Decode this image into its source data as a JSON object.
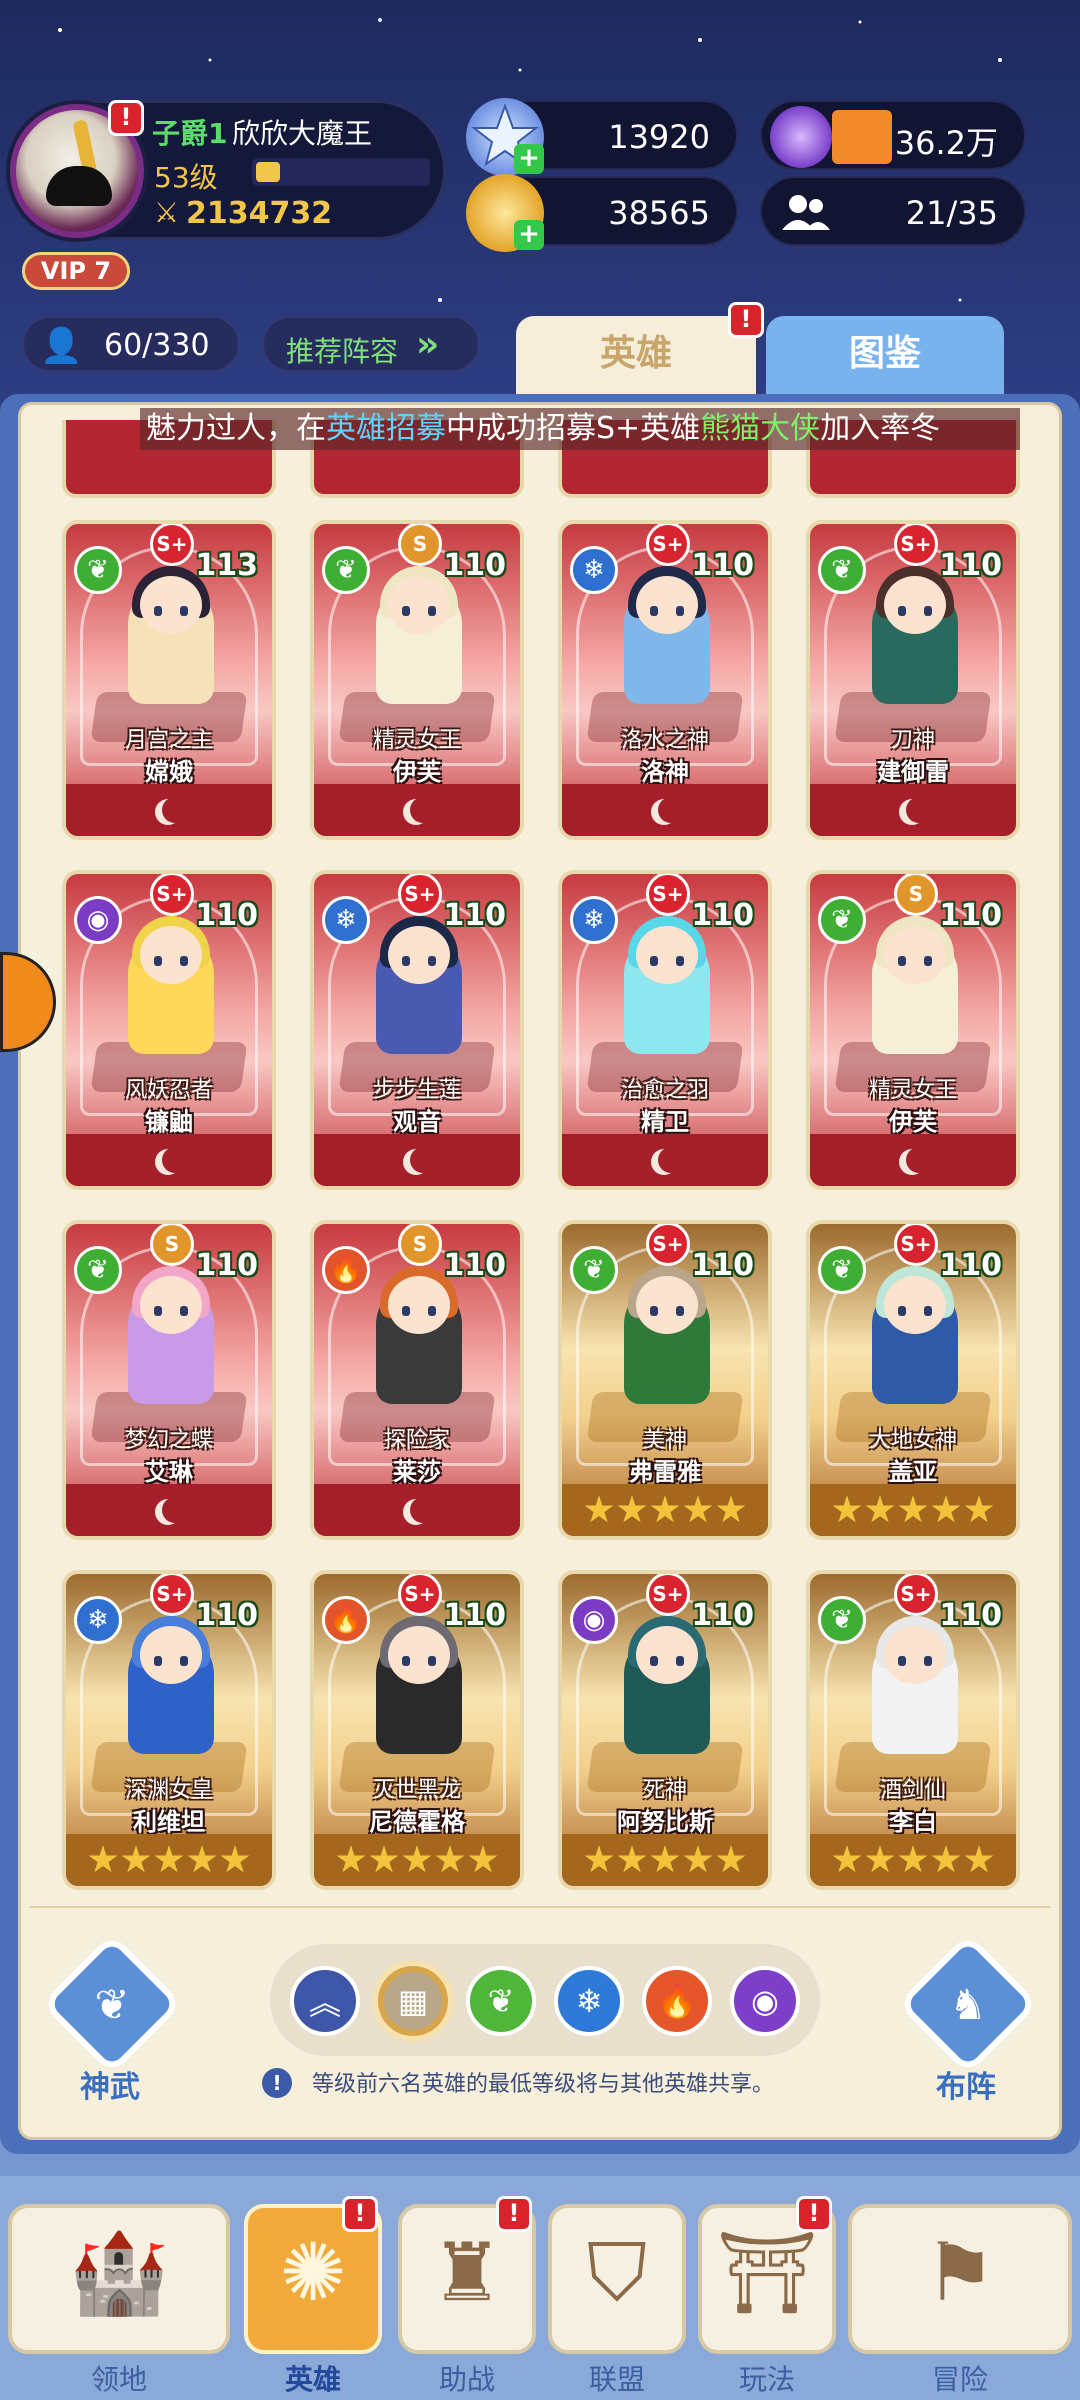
{
  "player": {
    "title": "子爵1",
    "name": "欣欣大魔王",
    "level": "53级",
    "exp_fraction": 0.14,
    "power": "2134732",
    "vip": "VIP 7",
    "alert": "!"
  },
  "resources": {
    "crystals": "13920",
    "gold": "38565",
    "energy": "36.2万",
    "population": "21/35"
  },
  "toolbar": {
    "hero_count": "60/330",
    "recommend_label": "推荐阵容"
  },
  "tabs": [
    {
      "label": "英雄",
      "active": true,
      "alert": "!"
    },
    {
      "label": "图鉴",
      "active": false
    }
  ],
  "marquee": {
    "prefix": "魅力过人，在",
    "link1": "英雄招募",
    "mid": "中成功招募S+英雄",
    "link2": "熊猫大侠",
    "suffix": "加入率冬"
  },
  "heroes": [
    {
      "grade": "S+",
      "element": "nature",
      "level": "113",
      "epithet": "月宫之主",
      "name": "嫦娥",
      "frame": "red"
    },
    {
      "grade": "S",
      "element": "nature",
      "level": "110",
      "epithet": "精灵女王",
      "name": "伊芙",
      "frame": "red"
    },
    {
      "grade": "S+",
      "element": "water",
      "level": "110",
      "epithet": "洛水之神",
      "name": "洛神",
      "frame": "red"
    },
    {
      "grade": "S+",
      "element": "nature",
      "level": "110",
      "epithet": "刀神",
      "name": "建御雷",
      "frame": "red"
    },
    {
      "grade": "S+",
      "element": "dark",
      "level": "110",
      "epithet": "风妖忍者",
      "name": "镰鼬",
      "frame": "red"
    },
    {
      "grade": "S+",
      "element": "water",
      "level": "110",
      "epithet": "步步生莲",
      "name": "观音",
      "frame": "red"
    },
    {
      "grade": "S+",
      "element": "water",
      "level": "110",
      "epithet": "治愈之羽",
      "name": "精卫",
      "frame": "red"
    },
    {
      "grade": "S",
      "element": "nature",
      "level": "110",
      "epithet": "精灵女王",
      "name": "伊芙",
      "frame": "red"
    },
    {
      "grade": "S",
      "element": "nature",
      "level": "110",
      "epithet": "梦幻之蝶",
      "name": "艾琳",
      "frame": "red"
    },
    {
      "grade": "S",
      "element": "fire",
      "level": "110",
      "epithet": "探险家",
      "name": "莱莎",
      "frame": "red"
    },
    {
      "grade": "S+",
      "element": "nature",
      "level": "110",
      "epithet": "美神",
      "name": "弗雷雅",
      "frame": "gold"
    },
    {
      "grade": "S+",
      "element": "nature",
      "level": "110",
      "epithet": "大地女神",
      "name": "盖亚",
      "frame": "gold"
    },
    {
      "grade": "S+",
      "element": "water",
      "level": "110",
      "epithet": "深渊女皇",
      "name": "利维坦",
      "frame": "gold"
    },
    {
      "grade": "S+",
      "element": "fire",
      "level": "110",
      "epithet": "灭世黑龙",
      "name": "尼德霍格",
      "frame": "gold"
    },
    {
      "grade": "S+",
      "element": "dark",
      "level": "110",
      "epithet": "死神",
      "name": "阿努比斯",
      "frame": "gold"
    },
    {
      "grade": "S+",
      "element": "nature",
      "level": "110",
      "epithet": "酒剑仙",
      "name": "李白",
      "frame": "gold"
    }
  ],
  "filters": [
    {
      "name": "rank-up",
      "color": "#3d56a8"
    },
    {
      "name": "all",
      "color": "#b9a78a",
      "selected": true
    },
    {
      "name": "nature",
      "color": "#4fb63a"
    },
    {
      "name": "water",
      "color": "#2f7ad8"
    },
    {
      "name": "fire",
      "color": "#e5572a"
    },
    {
      "name": "dark",
      "color": "#7d3ec8"
    }
  ],
  "side_buttons": {
    "left": "神武",
    "right": "布阵"
  },
  "info_text": "等级前六名英雄的最低等级将与其他英雄共享。",
  "bottom_nav": [
    {
      "label": "领地",
      "active": false,
      "alert": false
    },
    {
      "label": "英雄",
      "active": true,
      "alert": true
    },
    {
      "label": "助战",
      "active": false,
      "alert": true
    },
    {
      "label": "联盟",
      "active": false,
      "alert": false
    },
    {
      "label": "玩法",
      "active": false,
      "alert": true
    },
    {
      "label": "冒险",
      "active": false,
      "alert": false
    }
  ],
  "colors": {
    "accent_red": "#d9232e",
    "gold": "#f2c64a",
    "panel_blue": "#4b6fb8",
    "cream": "#f6efdc"
  }
}
